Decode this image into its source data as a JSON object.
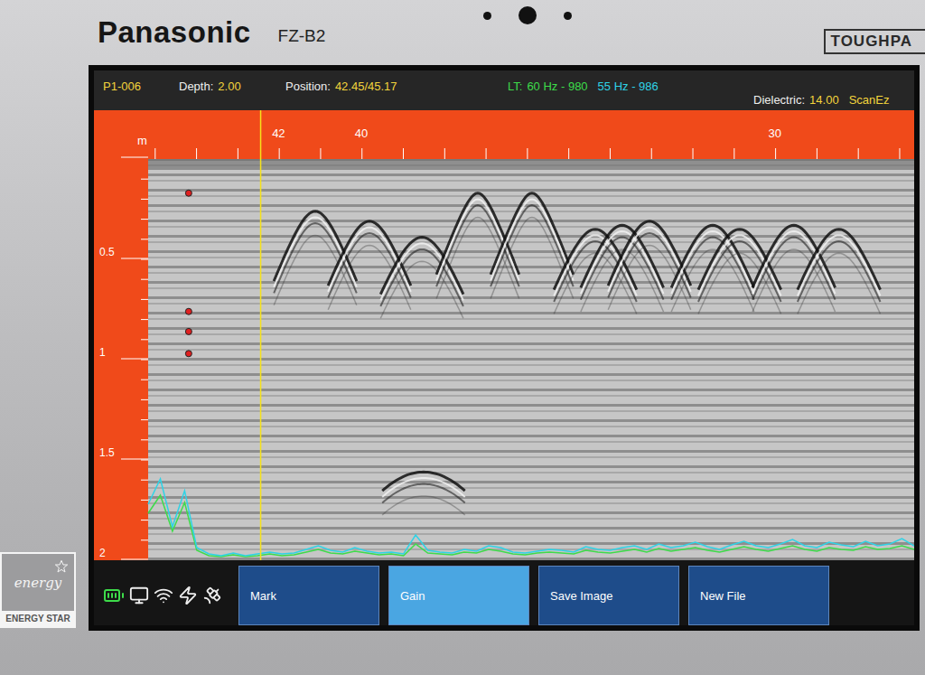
{
  "device": {
    "brand": "Panasonic",
    "model": "FZ-B2",
    "series": "TOUGHPA"
  },
  "energy_star": {
    "script": "energy",
    "label": "ENERGY STAR"
  },
  "header": {
    "file": "P1-006",
    "depth_label": "Depth:",
    "depth": "2.00",
    "position_label": "Position:",
    "position": "42.45/45.17",
    "lt_label": "LT:",
    "lines": [
      {
        "text": "60 Hz - 980",
        "color": "#3ddc4a"
      },
      {
        "text": "55 Hz - 986",
        "color": "#2fd3e6"
      }
    ],
    "dielectric_label": "Dielectric:",
    "dielectric": "14.00",
    "mode": "ScanEz"
  },
  "radargram": {
    "unit": "m",
    "x_range": [
      45.17,
      26.65
    ],
    "depth_range": [
      0,
      2
    ],
    "cursor_position": 42.45,
    "position_ticks": [
      {
        "label": "42",
        "value": 42
      },
      {
        "label": "40",
        "value": 40
      },
      {
        "label": "30",
        "value": 30
      }
    ],
    "depth_ticks": [
      {
        "label": "0.5",
        "value": 0.5
      },
      {
        "label": "1",
        "value": 1
      },
      {
        "label": "1.5",
        "value": 1.5
      },
      {
        "label": "2",
        "value": 2
      }
    ],
    "markers": [
      {
        "position": 44.19,
        "depth": 0.17
      },
      {
        "position": 44.19,
        "depth": 0.76
      },
      {
        "position": 44.19,
        "depth": 0.86
      },
      {
        "position": 44.19,
        "depth": 0.97
      }
    ],
    "hyperbolas": [
      {
        "position": 41.13,
        "depth": 0.26
      },
      {
        "position": 39.82,
        "depth": 0.31
      },
      {
        "position": 38.55,
        "depth": 0.39
      },
      {
        "position": 37.2,
        "depth": 0.17
      },
      {
        "position": 35.89,
        "depth": 0.17
      },
      {
        "position": 34.36,
        "depth": 0.35
      },
      {
        "position": 33.71,
        "depth": 0.33
      },
      {
        "position": 33.05,
        "depth": 0.31
      },
      {
        "position": 31.52,
        "depth": 0.33
      },
      {
        "position": 30.87,
        "depth": 0.35
      },
      {
        "position": 29.56,
        "depth": 0.33
      },
      {
        "position": 28.47,
        "depth": 0.35
      },
      {
        "position": 38.51,
        "depth": 1.56
      }
    ],
    "traces": [
      {
        "name": "60 Hz",
        "color": "#3ddc4a",
        "values": [
          50,
          70,
          30,
          62,
          9,
          3,
          2,
          4,
          2,
          3,
          5,
          3,
          4,
          7,
          10,
          6,
          5,
          8,
          6,
          4,
          5,
          3,
          16,
          6,
          5,
          4,
          7,
          6,
          10,
          8,
          5,
          4,
          6,
          7,
          6,
          5,
          9,
          7,
          6,
          8,
          10,
          7,
          11,
          8,
          10,
          12,
          9,
          7,
          10,
          13,
          10,
          8,
          11,
          14,
          10,
          8,
          12,
          10,
          9,
          13,
          10,
          11,
          14,
          10
        ]
      },
      {
        "name": "55 Hz",
        "color": "#2fd3e6",
        "values": [
          60,
          88,
          35,
          75,
          12,
          5,
          3,
          6,
          3,
          5,
          7,
          5,
          6,
          10,
          14,
          9,
          7,
          12,
          8,
          6,
          7,
          5,
          26,
          9,
          7,
          6,
          10,
          8,
          14,
          12,
          7,
          6,
          8,
          10,
          9,
          7,
          13,
          10,
          9,
          12,
          14,
          10,
          16,
          12,
          14,
          18,
          13,
          10,
          15,
          19,
          14,
          12,
          16,
          21,
          14,
          12,
          18,
          15,
          13,
          19,
          14,
          16,
          22,
          14
        ]
      }
    ]
  },
  "toolbar": [
    {
      "label": "Mark",
      "selected": false
    },
    {
      "label": "Gain",
      "selected": true
    },
    {
      "label": "Save Image",
      "selected": false
    },
    {
      "label": "New File",
      "selected": false
    }
  ]
}
